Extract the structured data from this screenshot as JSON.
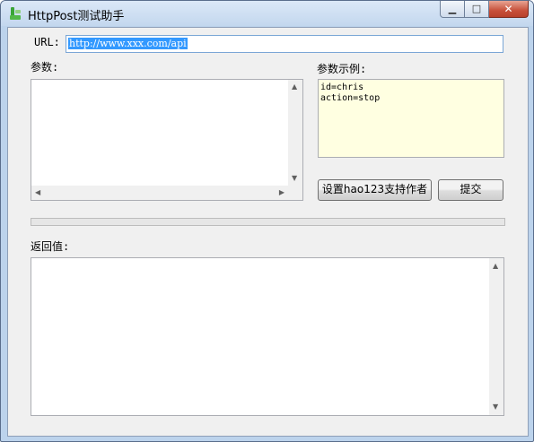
{
  "window": {
    "title": "HttpPost测试助手",
    "minimize_glyph": "▁",
    "maximize_glyph": "□",
    "close_glyph": "✕"
  },
  "url": {
    "label": "URL:",
    "value": "http://www.xxx.com/api"
  },
  "params": {
    "label": "参数:",
    "value": ""
  },
  "example": {
    "label": "参数示例:",
    "lines": [
      "id=chris",
      "action=stop"
    ]
  },
  "buttons": {
    "set_author": "设置hao123支持作者",
    "submit": "提交"
  },
  "progress": {
    "percent": 0
  },
  "result": {
    "label": "返回值:",
    "value": ""
  },
  "colors": {
    "title_bar": "#c3d7ee",
    "close_button": "#c7503a",
    "selection": "#3399ff",
    "example_background": "#ffffe1",
    "client_background": "#f0f0f0"
  },
  "icons": {
    "app": "httppost-app-icon",
    "scroll_up": "arrow-up-icon",
    "scroll_down": "arrow-down-icon",
    "scroll_left": "arrow-left-icon",
    "scroll_right": "arrow-right-icon"
  }
}
